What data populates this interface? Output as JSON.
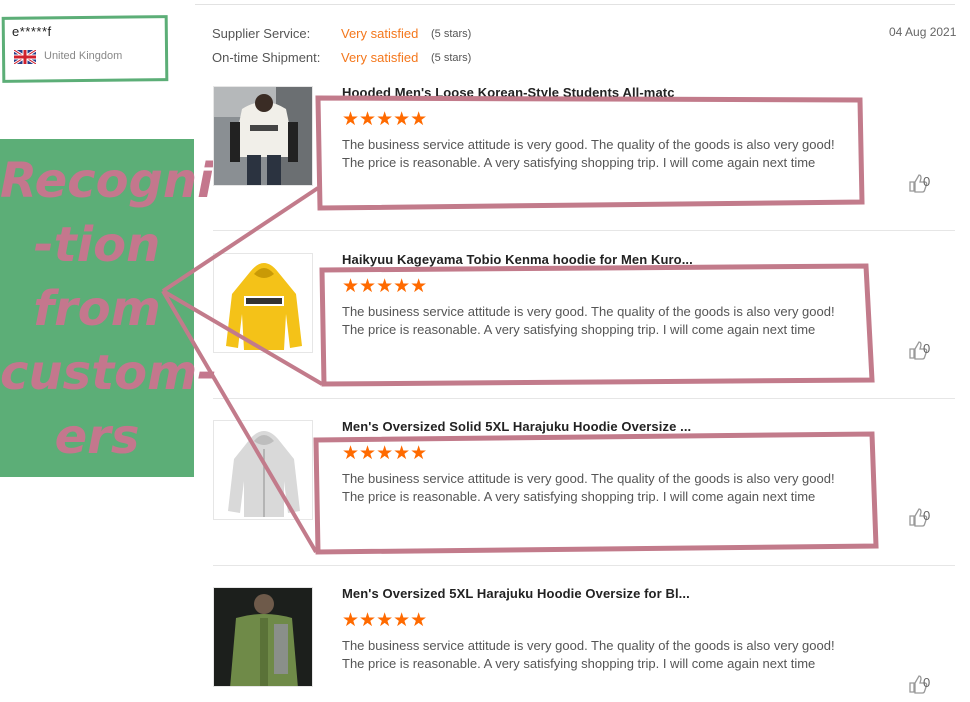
{
  "reviewer": {
    "name": "e*****f",
    "country": "United Kingdom",
    "flag_icon": "uk-flag-icon"
  },
  "overlay": {
    "text": "Recogni\n-tion\nfrom\ncustom-\ners"
  },
  "summary": {
    "supplier_label": "Supplier Service:",
    "supplier_value": "Very satisfied",
    "supplier_stars": "(5 stars)",
    "shipment_label": "On-time Shipment:",
    "shipment_value": "Very satisfied",
    "shipment_stars": "(5 stars)",
    "date": "04 Aug 2021"
  },
  "items": [
    {
      "title": "Hooded Men's Loose Korean-Style Students All-matc",
      "stars": "★★★★★",
      "rating": 5,
      "text": "The business service attitude is very good. The quality of the goods is also very good! The price is reasonable. A very satisfying shopping trip. I will come again next time",
      "likes": "0",
      "image_icon": "white-hoodie-photo"
    },
    {
      "title": "Haikyuu Kageyama Tobio Kenma hoodie for Men Kuro...",
      "stars": "★★★★★",
      "rating": 5,
      "text": "The business service attitude is very good. The quality of the goods is also very good! The price is reasonable. A very satisfying shopping trip. I will come again next time",
      "likes": "0",
      "image_icon": "yellow-hoodie-photo"
    },
    {
      "title": "Men's Oversized Solid 5XL Harajuku Hoodie Oversize ...",
      "stars": "★★★★★",
      "rating": 5,
      "text": "The business service attitude is very good. The quality of the goods is also very good! The price is reasonable. A very satisfying shopping trip. I will come again next time",
      "likes": "0",
      "image_icon": "grey-hoodie-photo"
    },
    {
      "title": "Men's Oversized 5XL Harajuku Hoodie Oversize for Bl...",
      "stars": "★★★★★",
      "rating": 5,
      "text": "The business service attitude is very good. The quality of the goods is also very good! The price is reasonable. A very satisfying shopping trip. I will come again next time",
      "likes": "0",
      "image_icon": "green-jacket-photo"
    }
  ],
  "colors": {
    "accent": "#f4771c",
    "star": "#ff6a00",
    "highlight_box": "#c27b8b",
    "overlay_bg": "#5cae77"
  }
}
